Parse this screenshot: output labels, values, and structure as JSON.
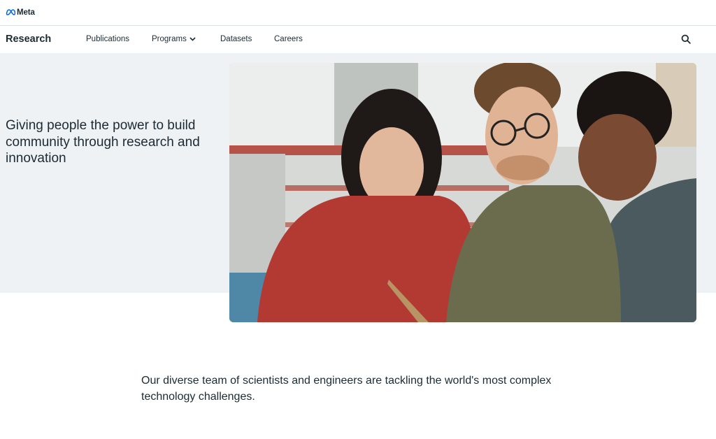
{
  "brand": {
    "name": "Meta",
    "logo_icon": "meta-infinity-logo"
  },
  "nav": {
    "title": "Research",
    "items": [
      {
        "label": "Publications"
      },
      {
        "label": "Programs",
        "icon": "chevron-down-icon"
      },
      {
        "label": "Datasets"
      },
      {
        "label": "Careers"
      }
    ],
    "search_icon": "search-icon"
  },
  "hero": {
    "heading": "Giving people the power to build community through research and innovation"
  },
  "intro": {
    "text": "Our diverse team of scientists and engineers are tackling the world's most complex technology challenges."
  },
  "colors": {
    "text": "#1c2b33",
    "hero_bg": "#eff2f5",
    "brand_blue": "#0668e1"
  }
}
